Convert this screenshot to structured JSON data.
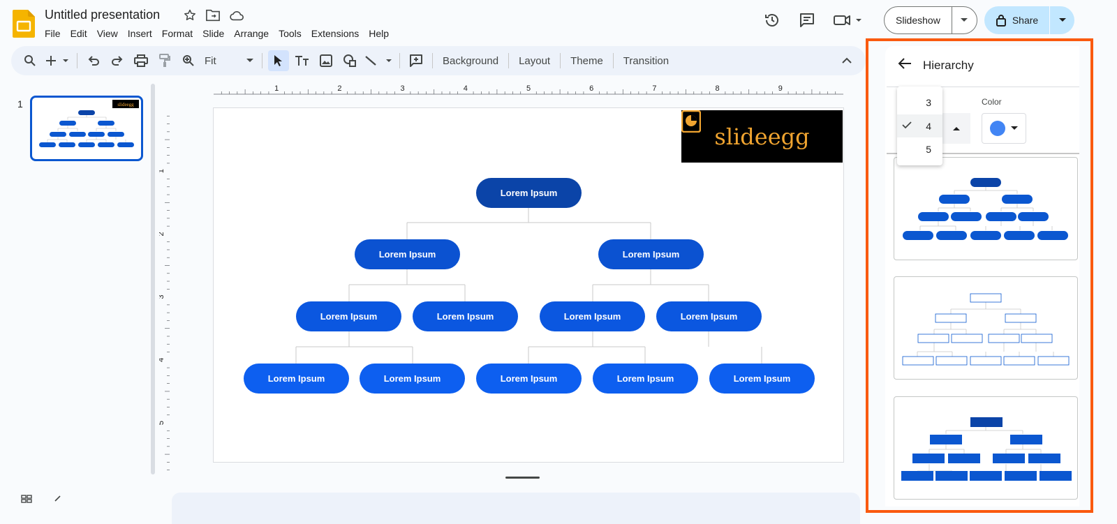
{
  "app": {
    "title": "Untitled presentation",
    "menu": [
      "File",
      "Edit",
      "View",
      "Insert",
      "Format",
      "Slide",
      "Arrange",
      "Tools",
      "Extensions",
      "Help"
    ],
    "slideshow_label": "Slideshow",
    "share_label": "Share",
    "accent": "#0b57d0",
    "share_bg": "#c2e7ff"
  },
  "toolbar": {
    "zoom_value": "Fit",
    "background_label": "Background",
    "layout_label": "Layout",
    "theme_label": "Theme",
    "transition_label": "Transition"
  },
  "filmstrip": {
    "slide_number": "1"
  },
  "rulers": {
    "horizontal": [
      "1",
      "2",
      "3",
      "4",
      "5",
      "6",
      "7",
      "8",
      "9"
    ],
    "vertical": [
      "1",
      "2",
      "3",
      "4",
      "5"
    ]
  },
  "slide": {
    "logo_text": "slideegg",
    "node_label": "Lorem Ipsum",
    "root_color": "#0b44a8",
    "level2_color": "#0b52d1",
    "level3_color": "#0b57e0",
    "level4_color": "#0d5ff0"
  },
  "panel": {
    "title": "Hierarchy",
    "color_label": "Color",
    "color_value": "#4285f4",
    "level_options": [
      "3",
      "4",
      "5"
    ],
    "selected_level": "4",
    "highlight_color": "#fa5a0f"
  }
}
